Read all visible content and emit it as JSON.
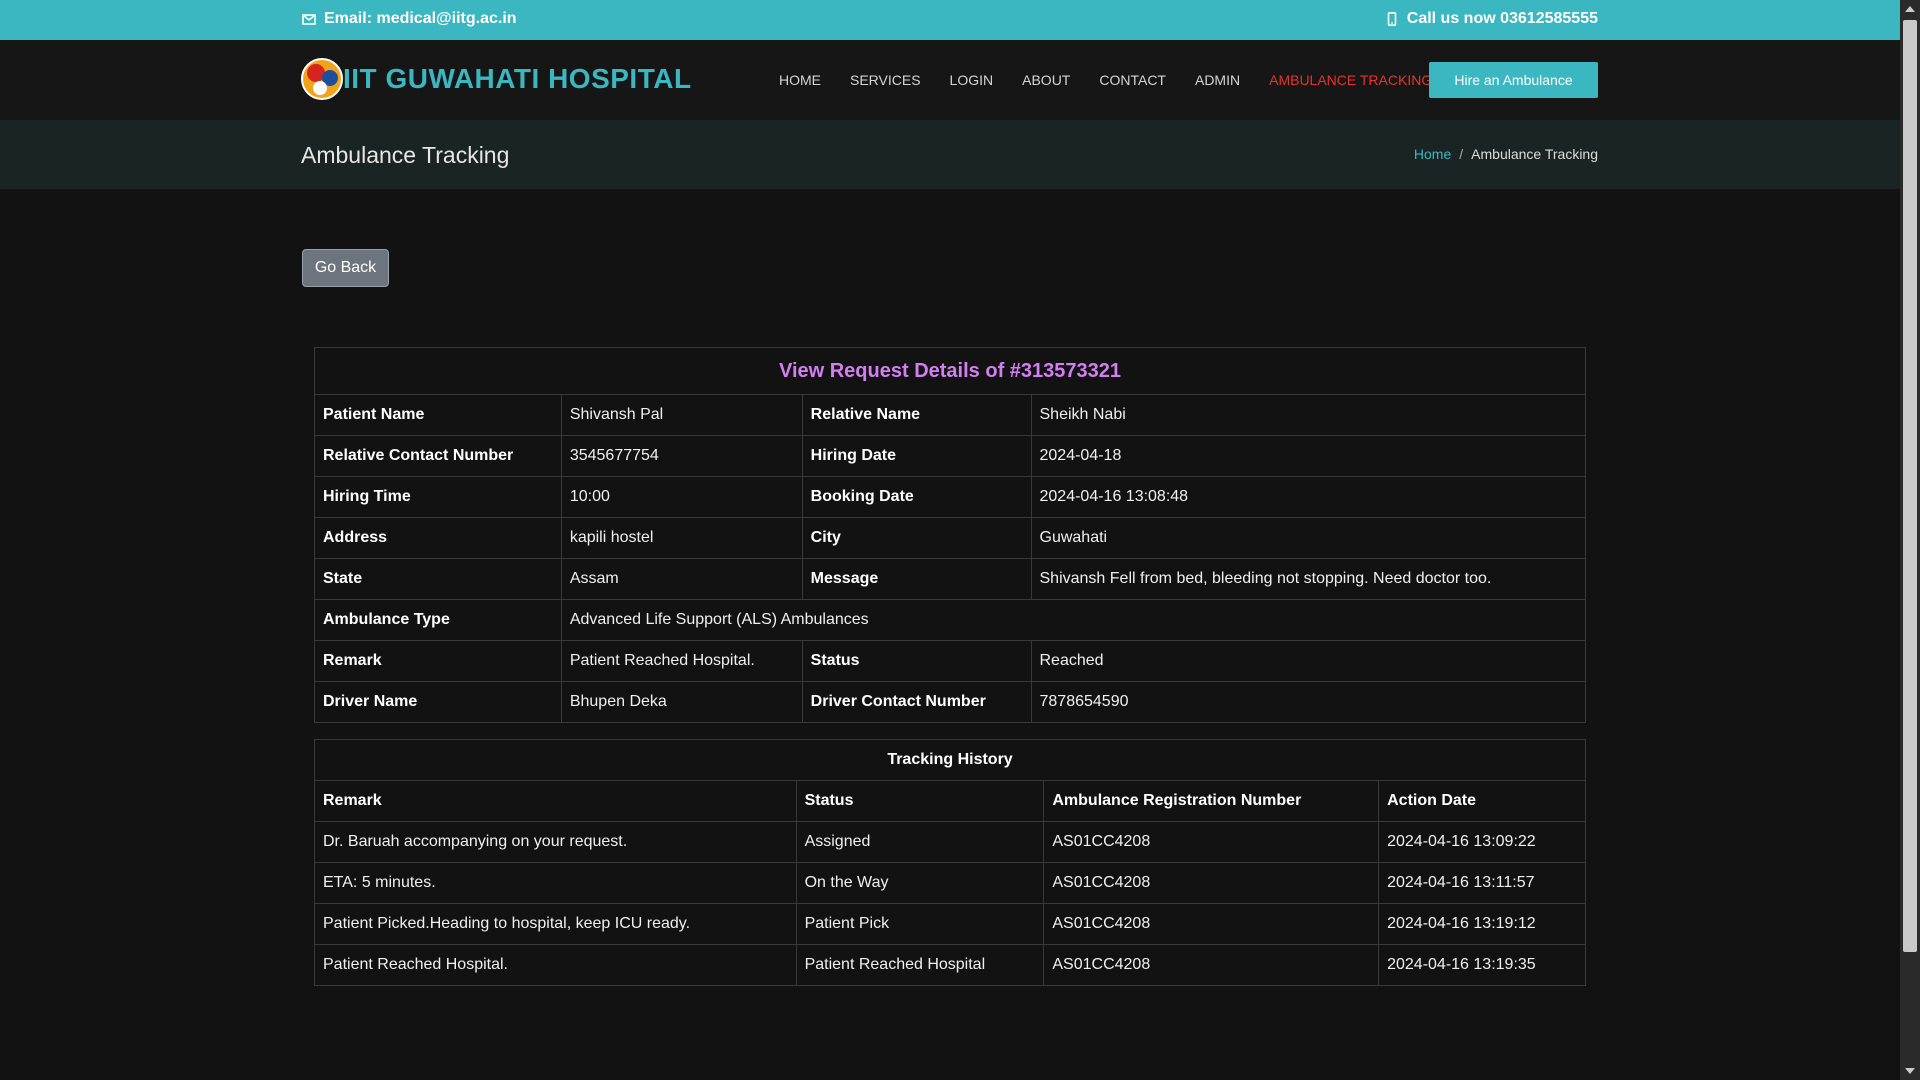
{
  "topbar": {
    "email_label": "Email: medical@iitg.ac.in",
    "phone_label": "Call us now 03612585555",
    "email_icon": "envelope-icon",
    "phone_icon": "mobile-phone-icon"
  },
  "header": {
    "brand": "IIT GUWAHATI HOSPITAL",
    "nav": [
      "HOME",
      "SERVICES",
      "LOGIN",
      "ABOUT",
      "CONTACT",
      "ADMIN",
      "AMBULANCE TRACKING"
    ],
    "active_nav": "AMBULANCE TRACKING",
    "cta": "Hire an Ambulance"
  },
  "pagebar": {
    "title": "Ambulance Tracking",
    "crumb_home": "Home",
    "crumb_sep": "/",
    "crumb_current": "Ambulance Tracking"
  },
  "go_back": "Go Back",
  "details": {
    "heading": "View Request Details of #313573321",
    "labels": {
      "patient_name": "Patient Name",
      "relative_name": "Relative Name",
      "relative_contact": "Relative Contact Number",
      "hiring_date": "Hiring Date",
      "hiring_time": "Hiring Time",
      "booking_date": "Booking Date",
      "address": "Address",
      "city": "City",
      "state": "State",
      "message": "Message",
      "ambulance_type": "Ambulance Type",
      "remark": "Remark",
      "status": "Status",
      "driver_name": "Driver Name",
      "driver_contact": "Driver Contact Number"
    },
    "values": {
      "patient_name": "Shivansh Pal",
      "relative_name": "Sheikh Nabi",
      "relative_contact": "3545677754",
      "hiring_date": "2024-04-18",
      "hiring_time": "10:00",
      "booking_date": "2024-04-16 13:08:48",
      "address": "kapili hostel",
      "city": "Guwahati",
      "state": "Assam",
      "message": "Shivansh Fell from bed, bleeding not stopping. Need doctor too.",
      "ambulance_type": "Advanced Life Support (ALS) Ambulances",
      "remark": "Patient Reached Hospital.",
      "status": "Reached",
      "driver_name": "Bhupen Deka",
      "driver_contact": "7878654590"
    }
  },
  "history": {
    "heading": "Tracking History",
    "columns": [
      "Remark",
      "Status",
      "Ambulance Registration Number",
      "Action Date"
    ],
    "rows": [
      [
        "Dr. Baruah accompanying on your request.",
        "Assigned",
        "AS01CC4208",
        "2024-04-16 13:09:22"
      ],
      [
        "ETA: 5 minutes.",
        "On the Way",
        "AS01CC4208",
        "2024-04-16 13:11:57"
      ],
      [
        "Patient Picked.Heading to hospital, keep ICU ready.",
        "Patient Pick",
        "AS01CC4208",
        "2024-04-16 13:19:12"
      ],
      [
        "Patient Reached Hospital.",
        "Patient Reached Hospital",
        "AS01CC4208",
        "2024-04-16 13:19:35"
      ]
    ]
  },
  "colors": {
    "accent": "#3ab7c0",
    "active_nav": "#e3342f",
    "heading": "#d37ff2",
    "background": "#121212"
  }
}
